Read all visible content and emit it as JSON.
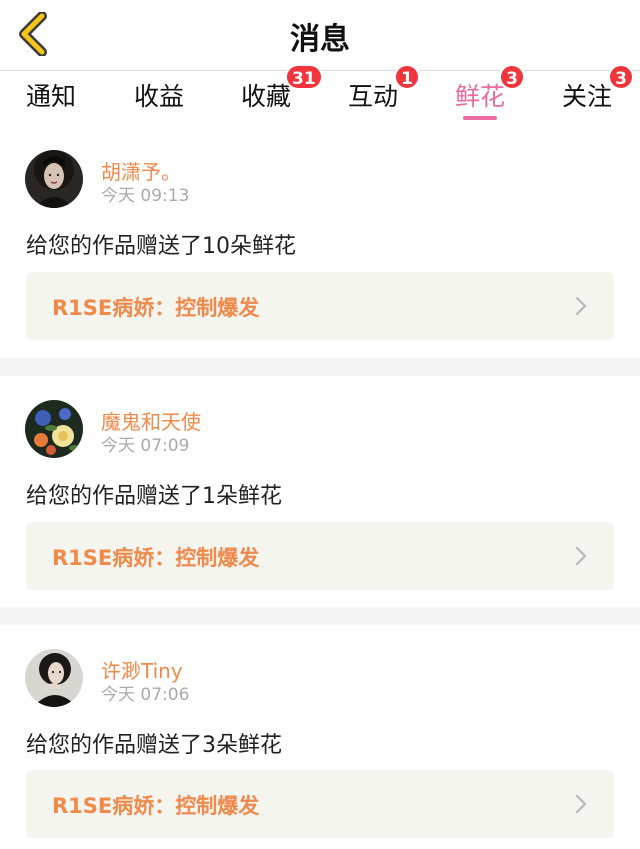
{
  "header": {
    "title": "消息"
  },
  "tabs": [
    {
      "label": "通知",
      "badge": ""
    },
    {
      "label": "收益",
      "badge": ""
    },
    {
      "label": "收藏",
      "badge": "31"
    },
    {
      "label": "互动",
      "badge": "1"
    },
    {
      "label": "鲜花",
      "badge": "3",
      "active": true
    },
    {
      "label": "关注",
      "badge": "3"
    }
  ],
  "messages": [
    {
      "username": "胡潇予。",
      "time": "今天 09:13",
      "text": "给您的作品赠送了10朵鲜花",
      "work_title": "R1SE病娇：控制爆发",
      "avatar": "avatar-woman-dark"
    },
    {
      "username": "魔鬼和天使",
      "time": "今天 07:09",
      "text": "给您的作品赠送了1朵鲜花",
      "work_title": "R1SE病娇：控制爆发",
      "avatar": "avatar-flowers"
    },
    {
      "username": "许渺Tiny",
      "time": "今天 07:06",
      "text": "给您的作品赠送了3朵鲜花",
      "work_title": "R1SE病娇：控制爆发",
      "avatar": "avatar-woman-portrait"
    }
  ],
  "colors": {
    "accent": "#ea6aa2",
    "username": "#f08a4b",
    "badge": "#f0353c",
    "back_icon": "#f5c518"
  },
  "icons": {
    "back": "chevron-left-icon",
    "work_link": "chevron-right-icon"
  }
}
